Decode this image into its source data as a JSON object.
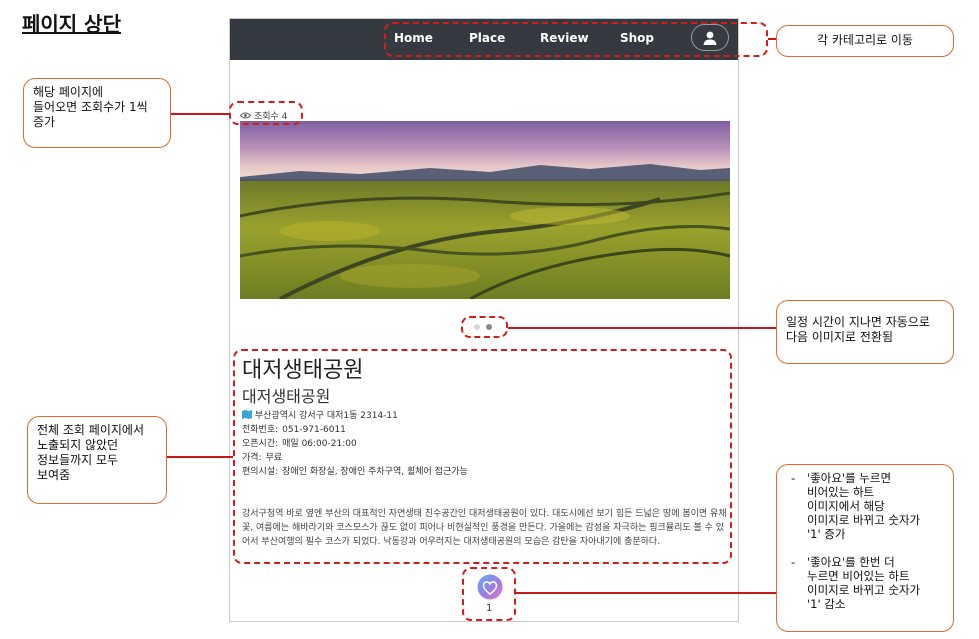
{
  "heading": "페이지 상단",
  "navbar": {
    "links": [
      "Home",
      "Place",
      "Review",
      "Shop"
    ],
    "profile_icon": "user-icon",
    "bg_color": "#343a40"
  },
  "views": {
    "icon": "eye-icon",
    "text": "조회수 4"
  },
  "carousel": {
    "dots_total": 2,
    "active_dot": 1
  },
  "place": {
    "title": "대저생태공원",
    "subtitle": "대저생태공원",
    "address_icon": "map-icon",
    "address": "부산광역시 강서구 대저1동 2314-11",
    "phone_label": "전화번호:",
    "phone": "051-971-6011",
    "hours_label": "오픈시간:",
    "hours": "매일 06:00-21:00",
    "price_label": "가격:",
    "price": "무료",
    "facilities_label": "편의시설:",
    "facilities": "장애인 화장실, 장애인 주차구역, 휠체어 접근가능",
    "description": "강서구청역 바로 옆엔 부산의 대표적인 자연생태 친수공간인 대저생태공원이 있다. 대도시에선 보기 힘든 드넓은 땅에 봄이면 유채꽃, 여름에는 해바라기와 코스모스가 끊도 없이 피어나 비현실적인 풍경을 만든다. 가을에는 감성을 자극하는 핑크뮬리도 볼 수 있어서 부산여행의 필수 코스가 되었다. 낙동강과 어우러지는 대저생태공원의 모습은 감탄을 자아내기에 충분하다."
  },
  "like": {
    "icon": "heart-icon",
    "count": "1"
  },
  "annotations": {
    "category": "각 카테고리로 이동",
    "views_1": "해당 페이지에",
    "views_2": "들어오면 조회수가 1씩",
    "views_3": "증가",
    "carousel_1": "일정 시간이 지나면 자동으로",
    "carousel_2": "다음 이미지로 전환됨",
    "info_1": "전체 조회 페이지에서",
    "info_2": "노출되지 않았던",
    "info_3": "정보들까지 모두",
    "info_4": "보여줌",
    "like_1": [
      "'좋아요'를 누르면",
      "비어있는 하트",
      "이미지에서 해당",
      "이미지로 바뀌고 숫자가",
      "'1' 증가"
    ],
    "like_2": [
      "'좋아요'를 한번 더",
      "누르면 비어있는 하트",
      "이미지로 바뀌고 숫자가",
      "'1' 감소"
    ]
  },
  "colors": {
    "annotation_red": "#d41c1c",
    "note_border": "#e06a2a"
  }
}
